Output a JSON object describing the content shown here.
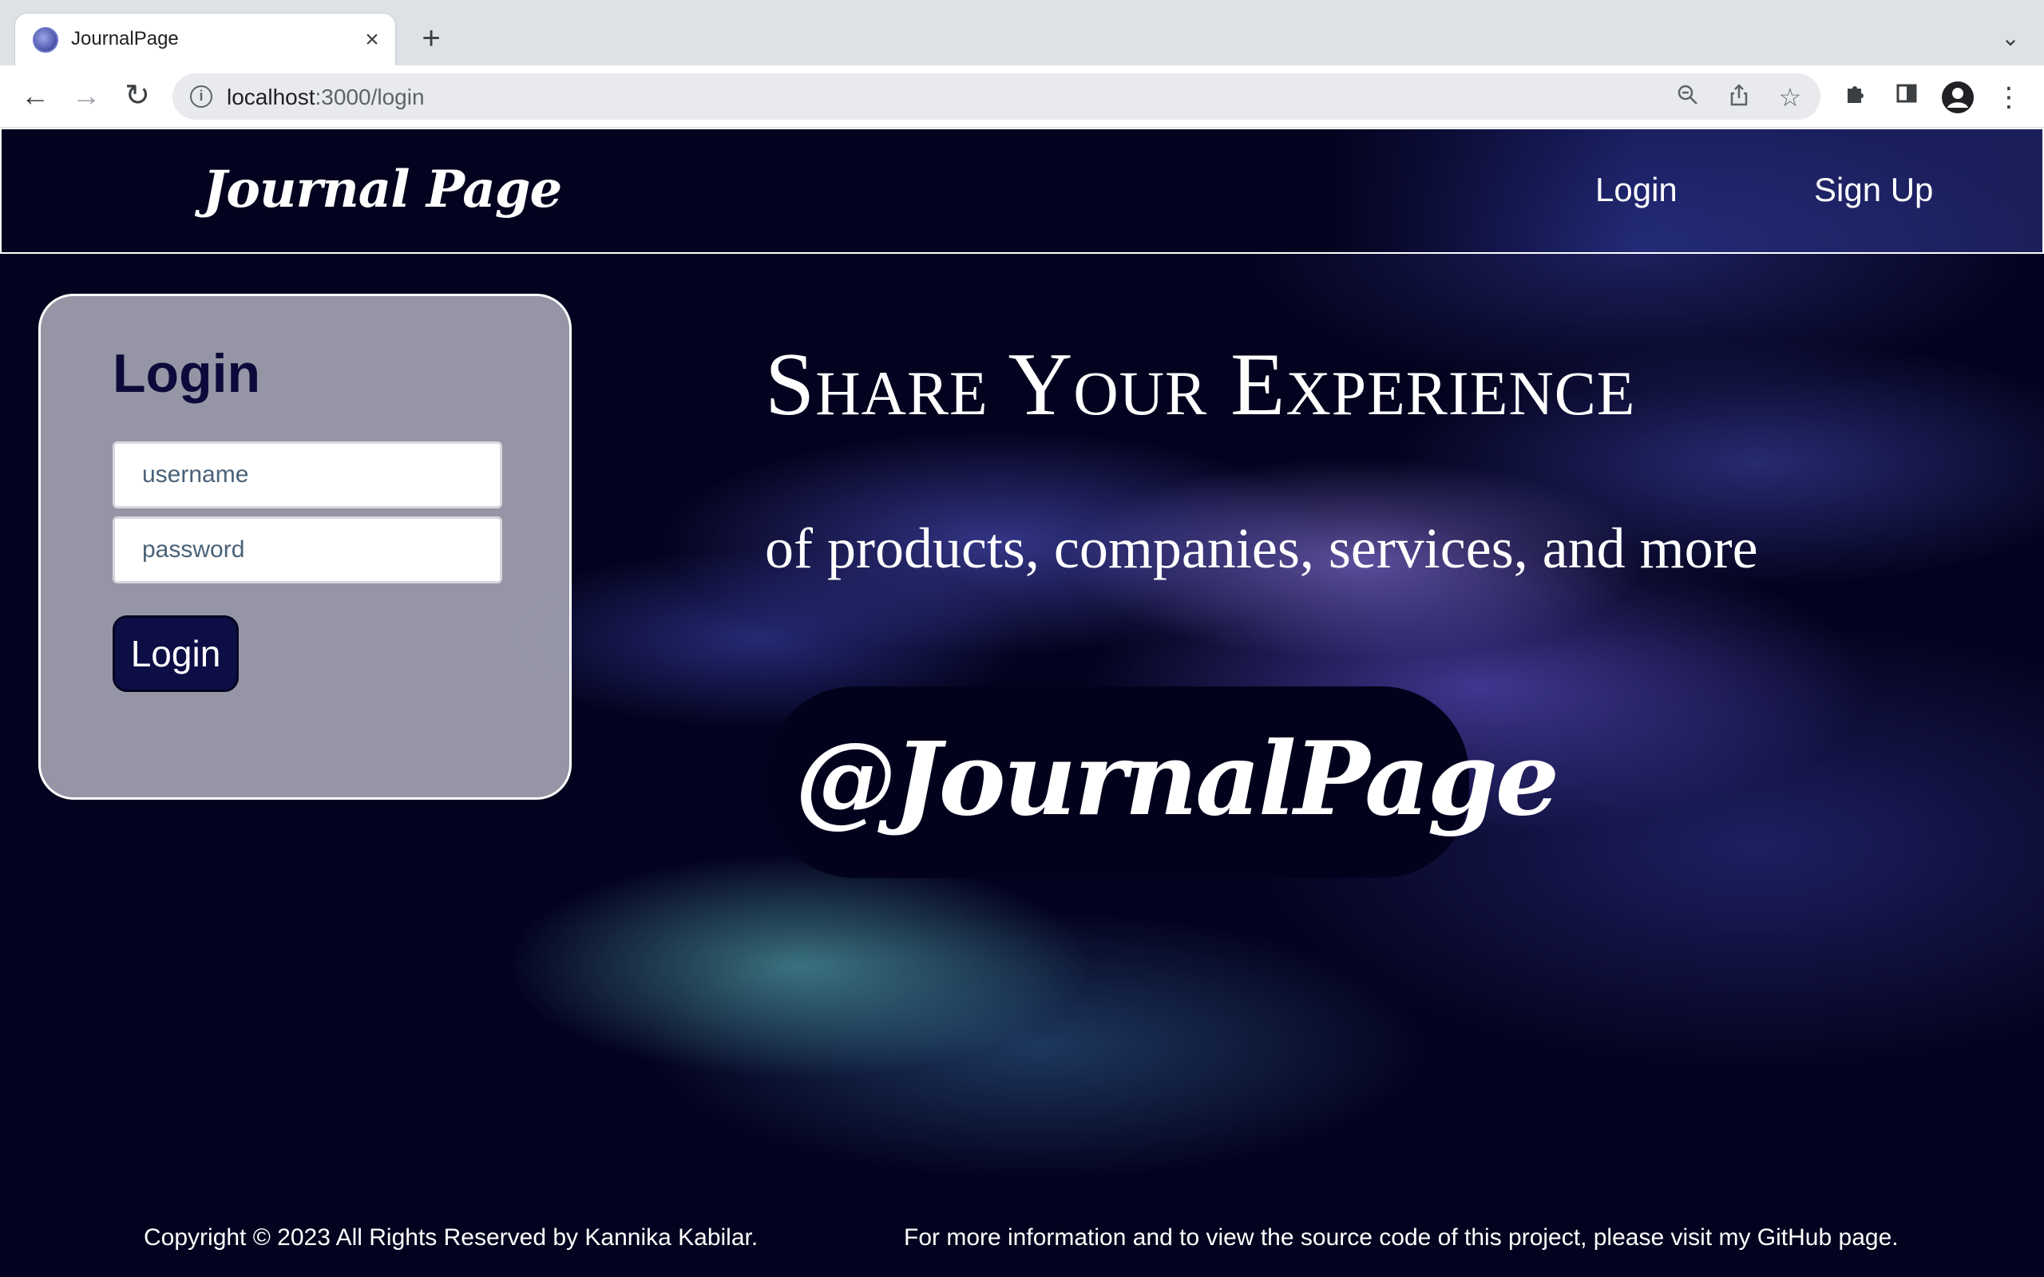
{
  "browser": {
    "tab_title": "JournalPage",
    "url_host": "localhost",
    "url_path": ":3000/login",
    "icons": {
      "favicon": "journalpage-favicon",
      "tab_close": "close-icon",
      "new_tab": "plus-icon",
      "tab_list": "chevron-down-icon",
      "back": "arrow-left-icon",
      "forward": "arrow-right-icon",
      "reload": "reload-icon",
      "site_info": "info-icon",
      "zoom": "zoom-out-icon",
      "share": "share-icon",
      "bookmark": "star-icon",
      "extensions": "puzzle-icon",
      "side_panel": "side-panel-icon",
      "profile": "profile-icon",
      "menu": "kebab-menu-icon"
    }
  },
  "header": {
    "logo": "Journal Page",
    "nav": {
      "login": "Login",
      "signup": "Sign Up"
    }
  },
  "login_form": {
    "title": "Login",
    "username_placeholder": "username",
    "password_placeholder": "password",
    "submit_label": "Login",
    "accent_color": "#0d0e45"
  },
  "hero": {
    "heading": "Share Your Experience",
    "subheading": "of products, companies, services, and more",
    "handle": "@JournalPage"
  },
  "footer": {
    "copyright": "Copyright © 2023 All Rights Reserved by Kannika Kabilar.",
    "info": "For more information and to view the source code of this project, please visit my GitHub page."
  },
  "colors": {
    "background": "#04031f",
    "card": "#aaaab9",
    "text": "#ffffff"
  }
}
